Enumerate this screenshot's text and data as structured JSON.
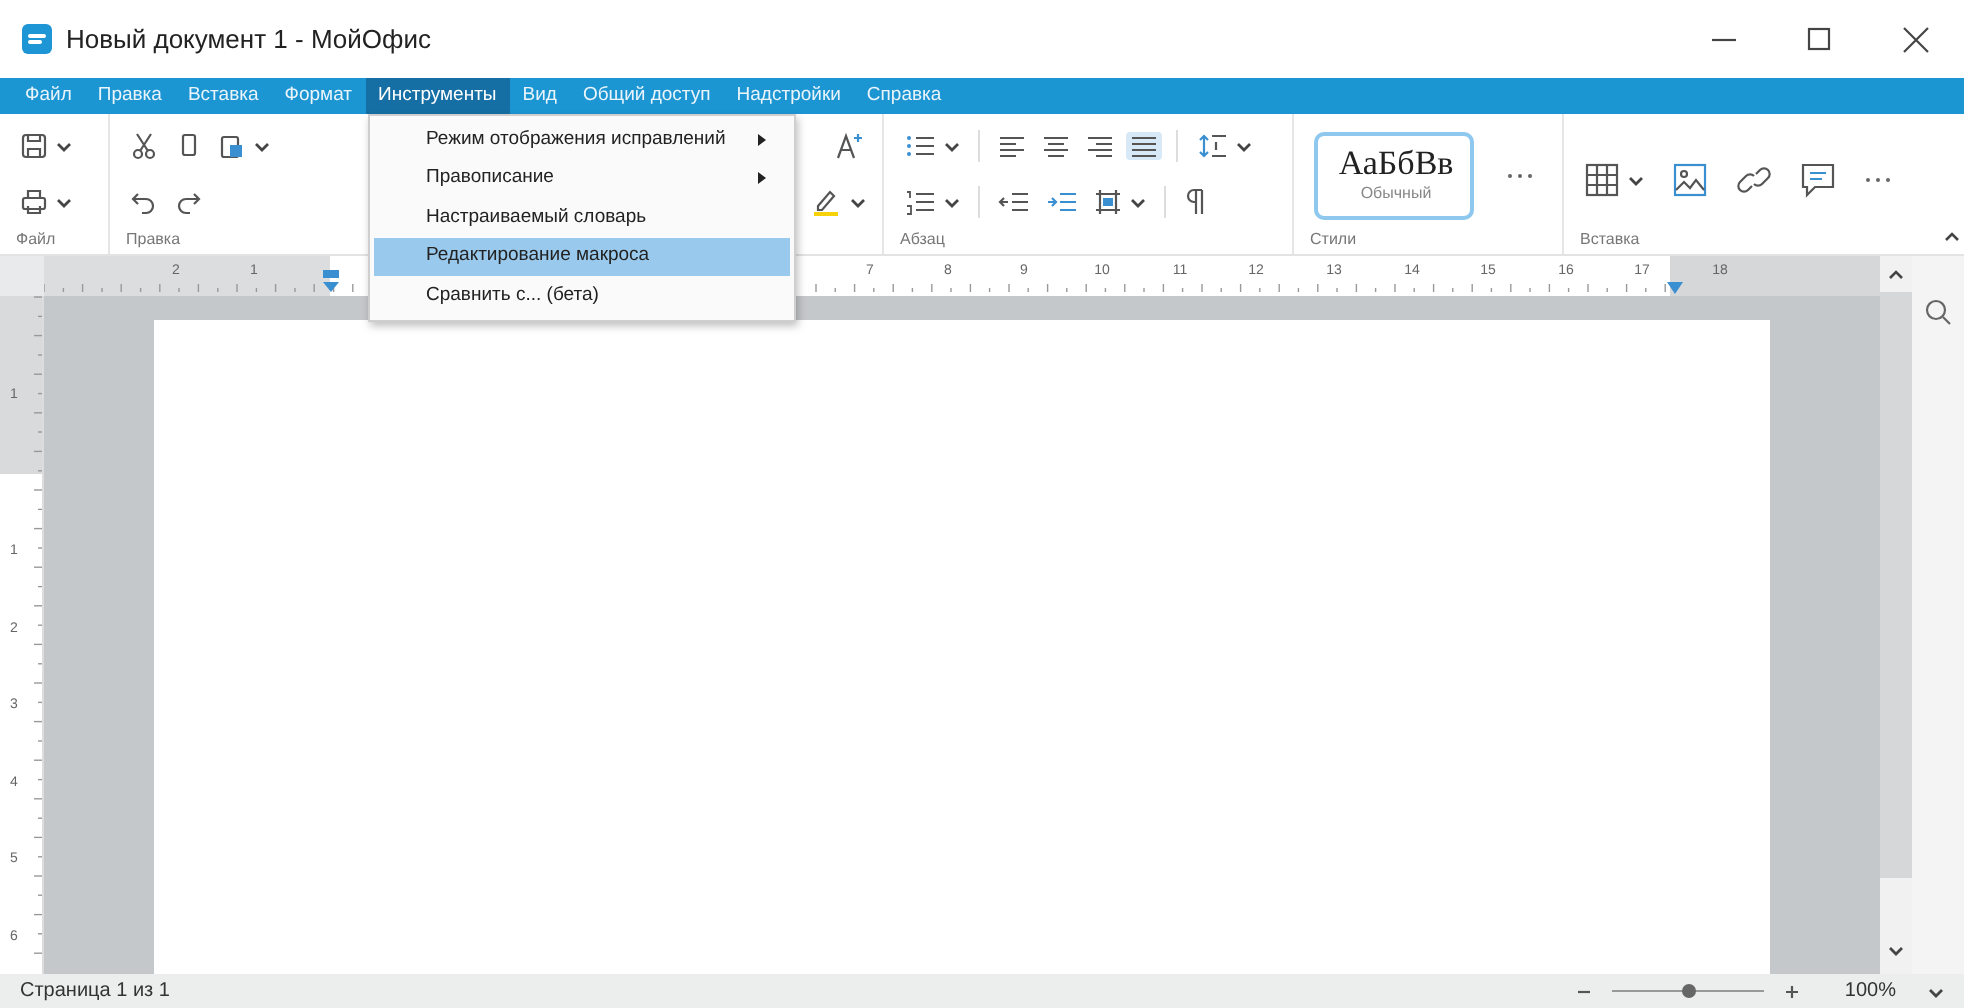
{
  "window": {
    "title": "Новый документ 1 - МойОфис"
  },
  "menu_bar": [
    {
      "label": "Файл",
      "selected": false
    },
    {
      "label": "Правка",
      "selected": false
    },
    {
      "label": "Вставка",
      "selected": false
    },
    {
      "label": "Формат",
      "selected": false
    },
    {
      "label": "Инструменты",
      "selected": true
    },
    {
      "label": "Вид",
      "selected": false
    },
    {
      "label": "Общий доступ",
      "selected": false
    },
    {
      "label": "Надстройки",
      "selected": false
    },
    {
      "label": "Справка",
      "selected": false
    }
  ],
  "tools_menu": [
    {
      "label": "Режим отображения исправлений",
      "submenu": true,
      "selected": false
    },
    {
      "label": "Правописание",
      "submenu": true,
      "selected": false
    },
    {
      "label": "Настраиваемый словарь",
      "submenu": false,
      "selected": false
    },
    {
      "label": "Редактирование макроса",
      "submenu": false,
      "selected": true
    },
    {
      "label": "Сравнить с... (бета)",
      "submenu": false,
      "selected": false
    }
  ],
  "ribbon": {
    "groups": [
      {
        "label": "Файл"
      },
      {
        "label": "Правка"
      },
      {
        "label": "Абзац"
      },
      {
        "label": "Стили"
      },
      {
        "label": "Вставка"
      }
    ],
    "align_buttons": [
      {
        "selected": false
      },
      {
        "selected": false
      },
      {
        "selected": false
      },
      {
        "selected": true
      }
    ],
    "style_preview": {
      "sample": "АаБбВв",
      "name": "Обычный"
    }
  },
  "ruler": {
    "horizontal": [
      "2",
      "1",
      "7",
      "8",
      "9",
      "10",
      "11",
      "12",
      "13",
      "14",
      "15",
      "16",
      "17",
      "18"
    ],
    "vertical": [
      "1",
      "1",
      "2",
      "3",
      "4",
      "5",
      "6"
    ]
  },
  "status_bar": {
    "page": "Страница 1 из 1",
    "zoom_slider": {
      "level": 0.5
    },
    "zoom": "100%"
  }
}
